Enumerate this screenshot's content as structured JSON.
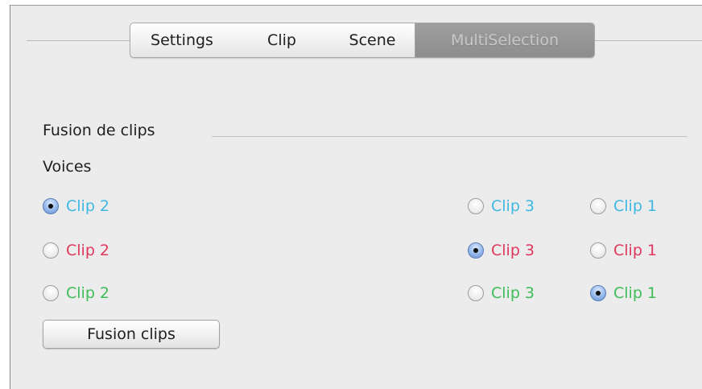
{
  "tabs": {
    "settings": "Settings",
    "clip": "Clip",
    "scene": "Scene",
    "multiselection": "MultiSelection"
  },
  "fusion": {
    "title": "Fusion de clips",
    "voices_label": "Voices",
    "button_label": "Fusion clips"
  },
  "colors": {
    "row1": "#3fb8e2",
    "row2": "#e0385c",
    "row3": "#3fbd5a",
    "selected_tab": "#8f8f8f"
  },
  "rows": [
    {
      "c2": "Clip 2",
      "c3": "Clip 3",
      "c1": "Clip 1",
      "selected": "Clip 2"
    },
    {
      "c2": "Clip 2",
      "c3": "Clip 3",
      "c1": "Clip 1",
      "selected": "Clip 3"
    },
    {
      "c2": "Clip 2",
      "c3": "Clip 3",
      "c1": "Clip 1",
      "selected": "Clip 1"
    }
  ]
}
